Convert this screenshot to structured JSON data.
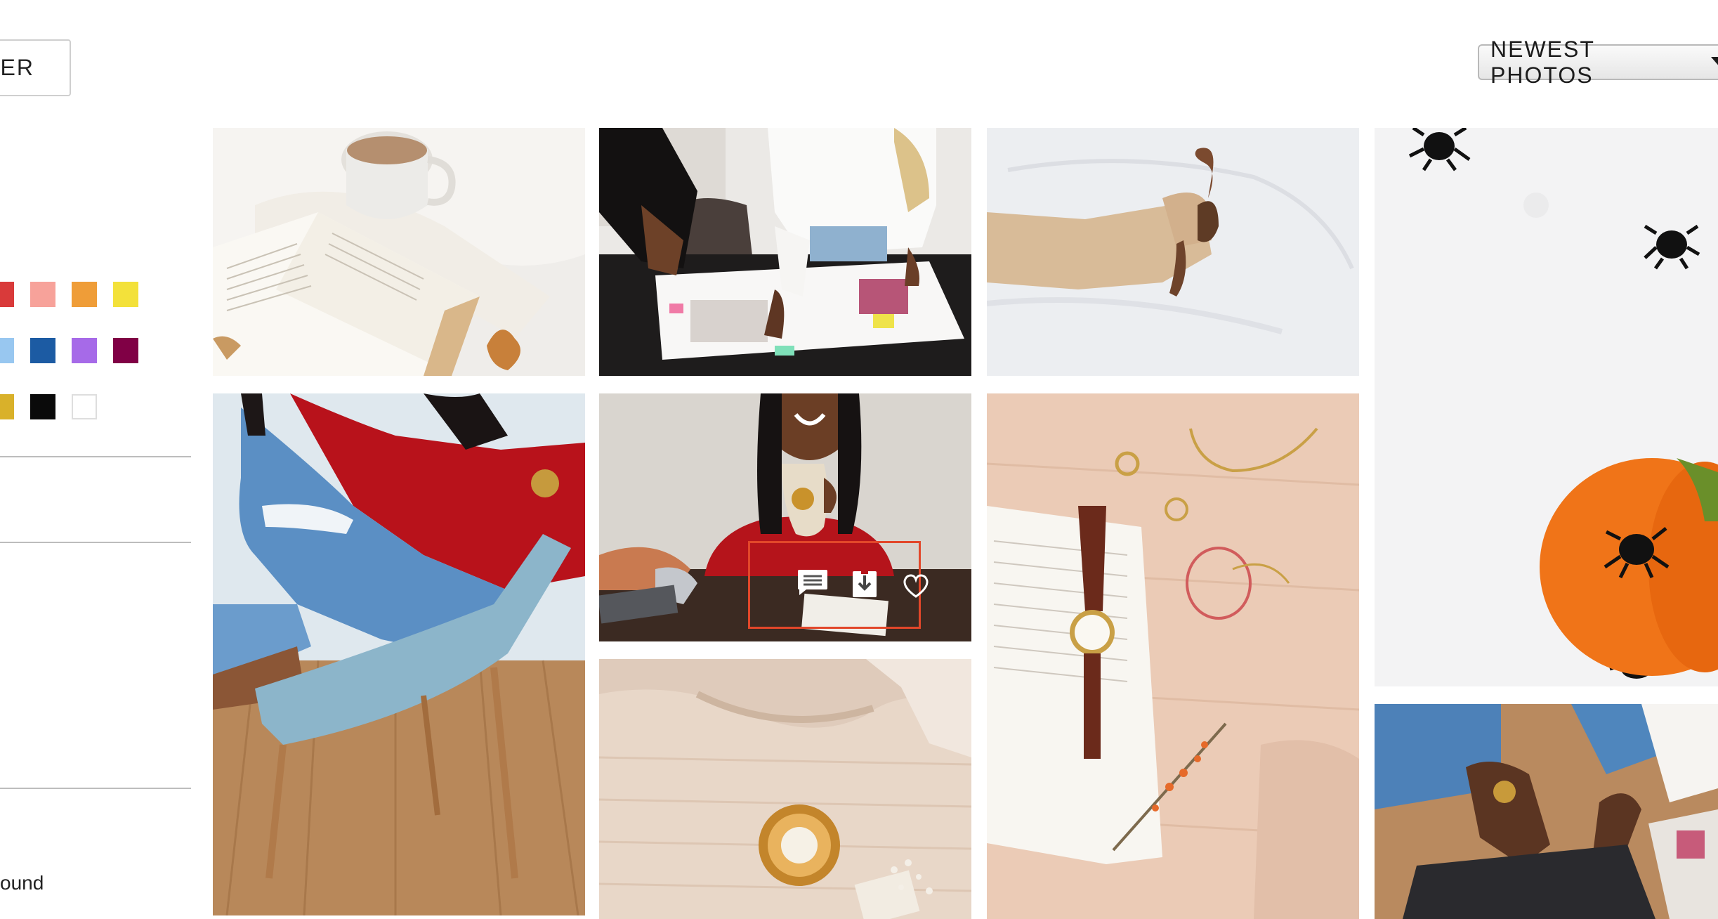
{
  "toolbar": {
    "filter_label": "ER",
    "sort_label": "NEWEST PHOTOS"
  },
  "sidebar": {
    "color_swatches": [
      {
        "name": "red",
        "hex": "#d93a3a"
      },
      {
        "name": "pink",
        "hex": "#f7a29a"
      },
      {
        "name": "orange",
        "hex": "#ef9d38"
      },
      {
        "name": "yellow",
        "hex": "#f3e13a"
      },
      {
        "name": "light-blue",
        "hex": "#98c7f0"
      },
      {
        "name": "navy",
        "hex": "#1c5ba3"
      },
      {
        "name": "purple",
        "hex": "#a66ae8"
      },
      {
        "name": "plum",
        "hex": "#800045"
      },
      {
        "name": "gold",
        "hex": "#d9b12a"
      },
      {
        "name": "black",
        "hex": "#0a0a0a"
      },
      {
        "name": "white",
        "hex": "#ffffff"
      }
    ],
    "bottom_label": "ound"
  },
  "photos": [
    {
      "name": "coffee-book-photo"
    },
    {
      "name": "moodboard-hands-photo"
    },
    {
      "name": "woman-lying-bed-photo"
    },
    {
      "name": "spiders-pumpkin-photo"
    },
    {
      "name": "woman-chair-jeans-photo"
    },
    {
      "name": "woman-mug-smile-photo"
    },
    {
      "name": "watch-jewelry-book-photo"
    },
    {
      "name": "sweater-candle-photo"
    },
    {
      "name": "laptop-hands-photo"
    }
  ],
  "overlay_actions": [
    "comment-icon",
    "download-icon",
    "heart-icon"
  ]
}
